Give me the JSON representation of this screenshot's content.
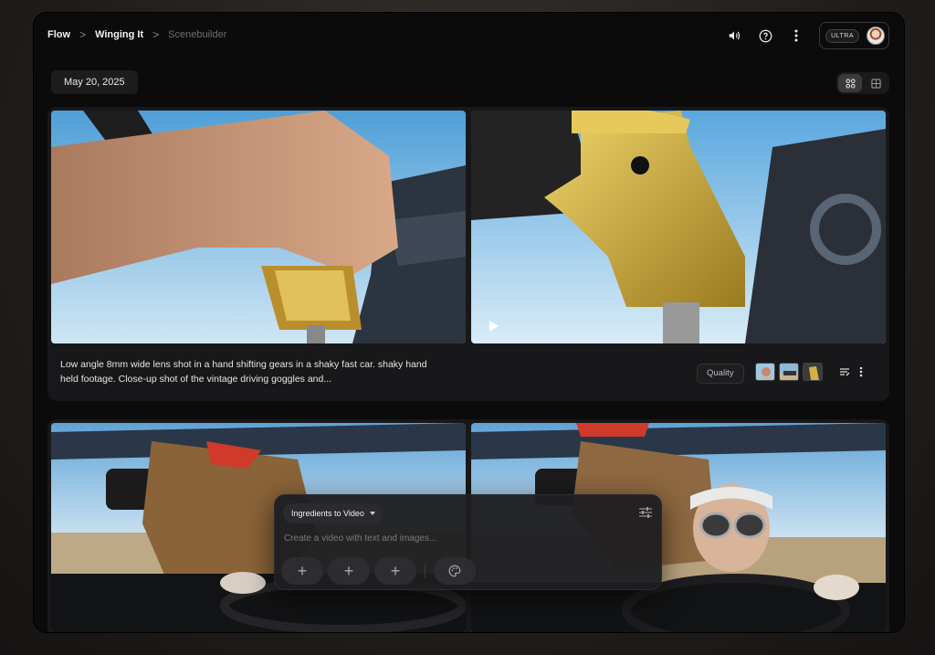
{
  "breadcrumb": {
    "items": [
      {
        "label": "Flow"
      },
      {
        "label": "Winging It"
      },
      {
        "label": "Scenebuilder"
      }
    ],
    "separator": ">"
  },
  "header": {
    "plan_badge": "ULTRA",
    "icons": [
      "volume-icon",
      "help-icon",
      "more-vert-icon"
    ]
  },
  "date_label": "May 20, 2025",
  "view_toggle": {
    "active": "grid-icon",
    "options": [
      "grid-icon",
      "list-grid-icon"
    ]
  },
  "scenes": [
    {
      "prompt": "Low angle 8mm wide lens shot in a hand shifting gears in a shaky fast car. shaky hand held footage. Close-up shot of the vintage driving goggles and...",
      "quality_label": "Quality",
      "reference_count": 3
    },
    {
      "prompt": ""
    }
  ],
  "composer": {
    "mode_label": "Ingredients to Video",
    "placeholder": "Create a video with text and images...",
    "add_buttons": [
      "+",
      "+",
      "+"
    ]
  }
}
